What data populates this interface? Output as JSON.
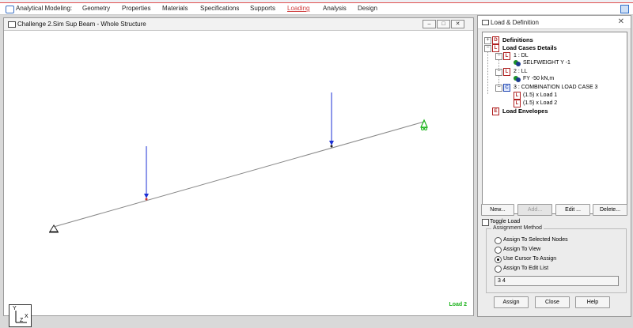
{
  "menu": {
    "label": "Analytical Modeling:",
    "tabs": [
      "Geometry",
      "Properties",
      "Materials",
      "Specifications",
      "Supports",
      "Loading",
      "Analysis",
      "Design"
    ],
    "active_tab": "Loading"
  },
  "view_window": {
    "title": "Challenge 2.Sim Sup Beam - Whole Structure",
    "buttons": [
      "–",
      "□",
      "✕"
    ],
    "load_label": "Load 2",
    "axis": {
      "y": "Y",
      "x": "X",
      "z": "Z"
    }
  },
  "panel": {
    "title": "Load & Definition",
    "close_glyph": "✕",
    "tree": {
      "definitions": "Definitions",
      "load_cases": "Load Cases Details",
      "case1": "1 : DL",
      "case1_item": "SELFWEIGHT Y -1",
      "case2": "2 : LL",
      "case2_item": "FY -50 kN,m",
      "case3": "3 : COMBINATION LOAD CASE 3",
      "case3_item1": "(1.5) x Load 1",
      "case3_item2": "(1.5) x Load 2",
      "envelopes": "Load Envelopes"
    },
    "buttons": {
      "new": "New...",
      "add": "Add...",
      "edit": "Edit ...",
      "delete": "Delete..."
    },
    "toggle_load": "Toggle Load",
    "assignment": {
      "title": "Assignment Method",
      "options": [
        "Assign To Selected Nodes",
        "Assign To View",
        "Use Cursor To Assign",
        "Assign To Edit List"
      ],
      "selected": "Use Cursor To Assign",
      "edit_list": "3 4"
    },
    "bottom_buttons": {
      "assign": "Assign",
      "close": "Close",
      "help": "Help"
    }
  },
  "colors": {
    "accent": "#d04040",
    "load_arrow": "#1b2fd6",
    "load_label": "#1bb21b"
  }
}
